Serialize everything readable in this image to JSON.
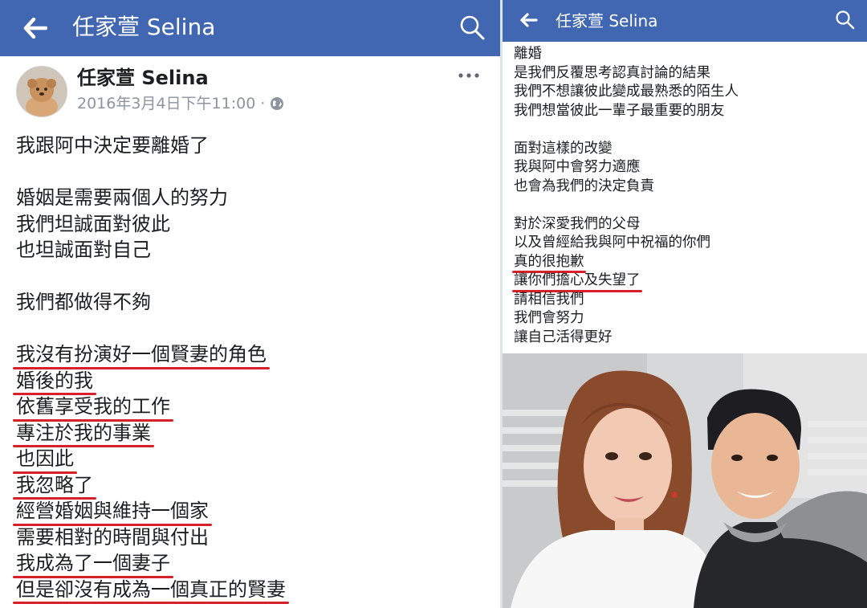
{
  "left_panel": {
    "header": {
      "title": "任家萱 Selina"
    },
    "post": {
      "author": "任家萱 Selina",
      "timestamp": "2016年3月4日下午11:00",
      "lines": [
        {
          "text": "我跟阿中決定要離婚了",
          "underlined": false
        },
        {
          "text": "",
          "underlined": false
        },
        {
          "text": "婚姻是需要兩個人的努力",
          "underlined": false
        },
        {
          "text": "我們坦誠面對彼此",
          "underlined": false
        },
        {
          "text": "也坦誠面對自己",
          "underlined": false
        },
        {
          "text": "",
          "underlined": false
        },
        {
          "text": "我們都做得不夠",
          "underlined": false
        },
        {
          "text": "",
          "underlined": false
        },
        {
          "text": "我沒有扮演好一個賢妻的角色",
          "underlined": true
        },
        {
          "text": "婚後的我",
          "underlined": true
        },
        {
          "text": "依舊享受我的工作",
          "underlined": true
        },
        {
          "text": "專注於我的事業",
          "underlined": true
        },
        {
          "text": "也因此",
          "underlined": true
        },
        {
          "text": "我忽略了",
          "underlined": true
        },
        {
          "text": "經營婚姻與維持一個家",
          "underlined": true
        },
        {
          "text": "需要相對的時間與付出",
          "underlined": false
        },
        {
          "text": "我成為了一個妻子",
          "underlined": true
        },
        {
          "text": "但是卻沒有成為一個真正的賢妻",
          "underlined": true
        }
      ]
    }
  },
  "right_panel": {
    "header": {
      "title": "任家萱 Selina"
    },
    "lines": [
      {
        "text": "離婚",
        "underlined": false
      },
      {
        "text": "是我們反覆思考認真討論的結果",
        "underlined": false
      },
      {
        "text": "我們不想讓彼此變成最熟悉的陌生人",
        "underlined": false
      },
      {
        "text": "我們想當彼此一輩子最重要的朋友",
        "underlined": false
      },
      {
        "text": "",
        "underlined": false
      },
      {
        "text": "面對這樣的改變",
        "underlined": false
      },
      {
        "text": "我與阿中會努力適應",
        "underlined": false
      },
      {
        "text": "也會為我們的決定負責",
        "underlined": false
      },
      {
        "text": "",
        "underlined": false
      },
      {
        "text": "對於深愛我們的父母",
        "underlined": false
      },
      {
        "text": "以及曾經給我與阿中祝福的你們",
        "underlined": false
      },
      {
        "text": "真的很抱歉",
        "underlined": true
      },
      {
        "text": "讓你們擔心及失望了",
        "underlined": true
      },
      {
        "text": "請相信我們",
        "underlined": false
      },
      {
        "text": "我們會努力",
        "underlined": false
      },
      {
        "text": "讓自己活得更好",
        "underlined": false
      }
    ]
  },
  "icons": {
    "back": "arrow-left-icon",
    "search": "search-icon",
    "more": "more-horizontal-icon",
    "privacy": "globe-icon"
  },
  "colors": {
    "header_bg": "#4267b2",
    "underline": "#d6202b",
    "meta_text": "#8d949e"
  }
}
